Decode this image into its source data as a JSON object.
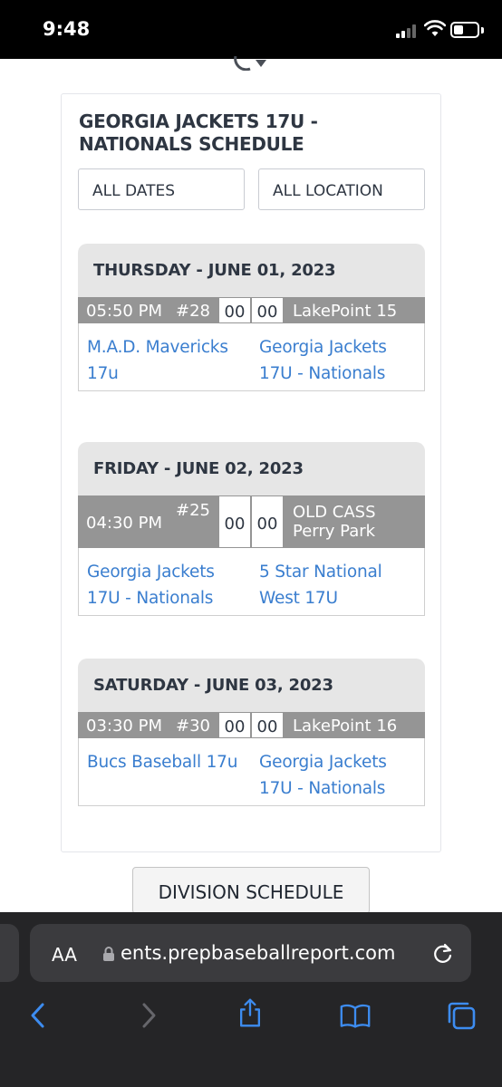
{
  "status_bar": {
    "time": "9:48"
  },
  "schedule": {
    "title": "GEORGIA JACKETS 17U - NATIONALS SCHEDULE",
    "filters": {
      "dates": "ALL DATES",
      "location": "ALL LOCATION"
    },
    "days": [
      {
        "date": "THURSDAY - JUNE 01, 2023",
        "time": "05:50 PM",
        "game_number": "#28",
        "score_home": "00",
        "score_away": "00",
        "location": "LakePoint 15",
        "location_line2": "",
        "home_team": "M.A.D. Mavericks 17u",
        "away_team": "Georgia Jackets 17U - Nationals"
      },
      {
        "date": "FRIDAY - JUNE 02, 2023",
        "time": "04:30 PM",
        "game_number": "#25",
        "score_home": "00",
        "score_away": "00",
        "location": "OLD CASS",
        "location_line2": "Perry Park",
        "home_team": "Georgia Jackets 17U - Nationals",
        "away_team": "5 Star National West 17U"
      },
      {
        "date": "SATURDAY - JUNE 03, 2023",
        "time": "03:30 PM",
        "game_number": "#30",
        "score_home": "00",
        "score_away": "00",
        "location": "LakePoint 16",
        "location_line2": "",
        "home_team": "Bucs Baseball 17u",
        "away_team": "Georgia Jackets 17U - Nationals"
      }
    ],
    "division_button": "DIVISION SCHEDULE"
  },
  "browser": {
    "aa_label": "AA",
    "url": "ents.prepbaseballreport.com"
  },
  "colors": {
    "link": "#3a7ecf",
    "header_bg": "#e6e6e6",
    "game_bar_bg": "#959595",
    "browser_bg": "#252527",
    "browser_icon": "#3d8cf0"
  },
  "icons": [
    "signal-icon",
    "wifi-icon",
    "battery-icon",
    "lock-icon",
    "reload-icon",
    "back-icon",
    "forward-icon",
    "share-icon",
    "bookmarks-icon",
    "tabs-icon"
  ]
}
